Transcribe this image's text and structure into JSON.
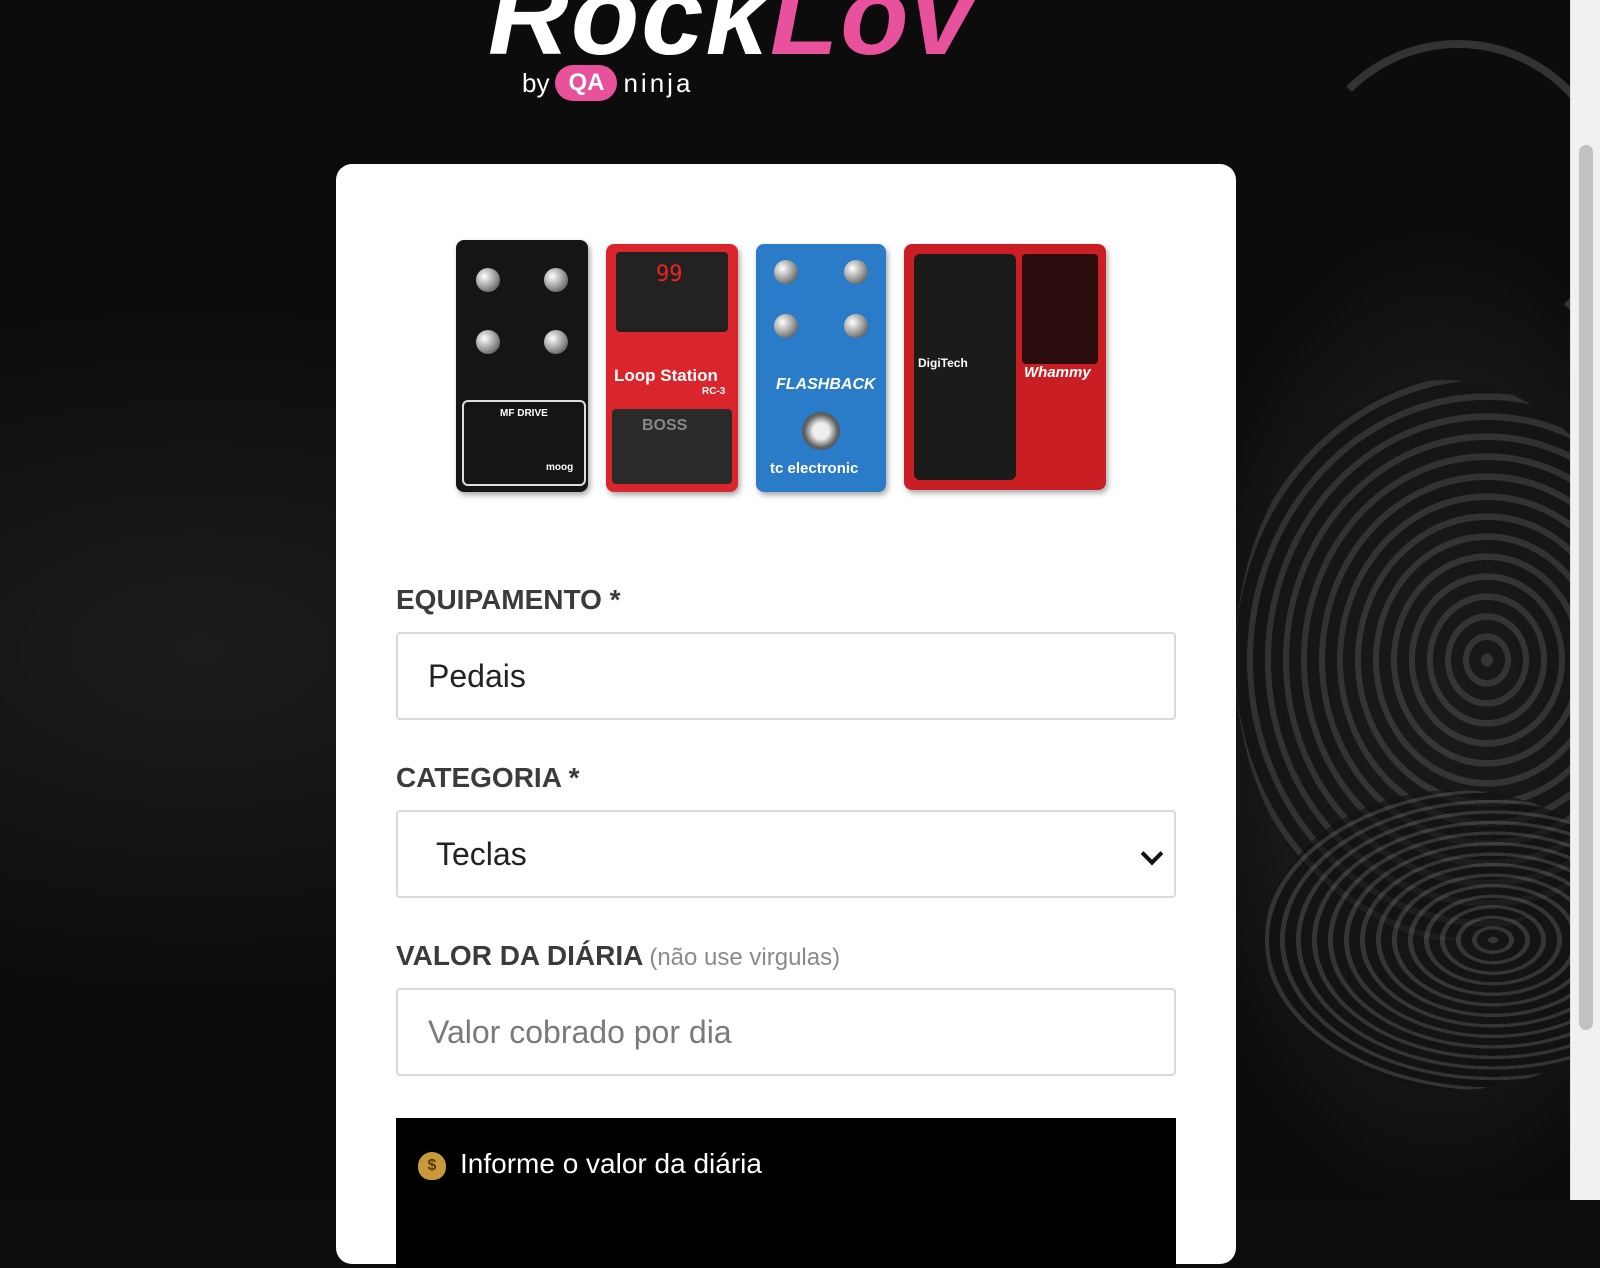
{
  "logo": {
    "part1": "Rock",
    "part2": "Lov",
    "by": "by",
    "qa": "QA",
    "ninja": "ninja"
  },
  "pedals": {
    "moog_name": "MF DRIVE",
    "moog_brand": "moog",
    "boss_display": "99",
    "boss_name": "Loop Station",
    "boss_model": "RC-3",
    "boss_brand": "BOSS",
    "tc_name": "FLASHBACK",
    "tc_brand": "tc electronic",
    "digitech_brand": "DigiTech",
    "whammy_name": "Whammy"
  },
  "form": {
    "equipamento_label": "EQUIPAMENTO *",
    "equipamento_value": "Pedais",
    "categoria_label": "CATEGORIA *",
    "categoria_value": "Teclas",
    "valor_label": "VALOR DA DIÁRIA",
    "valor_hint": "(não use virgulas)",
    "valor_placeholder": "Valor cobrado por dia"
  },
  "alert": {
    "message": "Informe o valor da diária",
    "icon": "money-bag-icon"
  },
  "colors": {
    "brand_pink": "#e8519c",
    "alert_bg": "#000000"
  }
}
